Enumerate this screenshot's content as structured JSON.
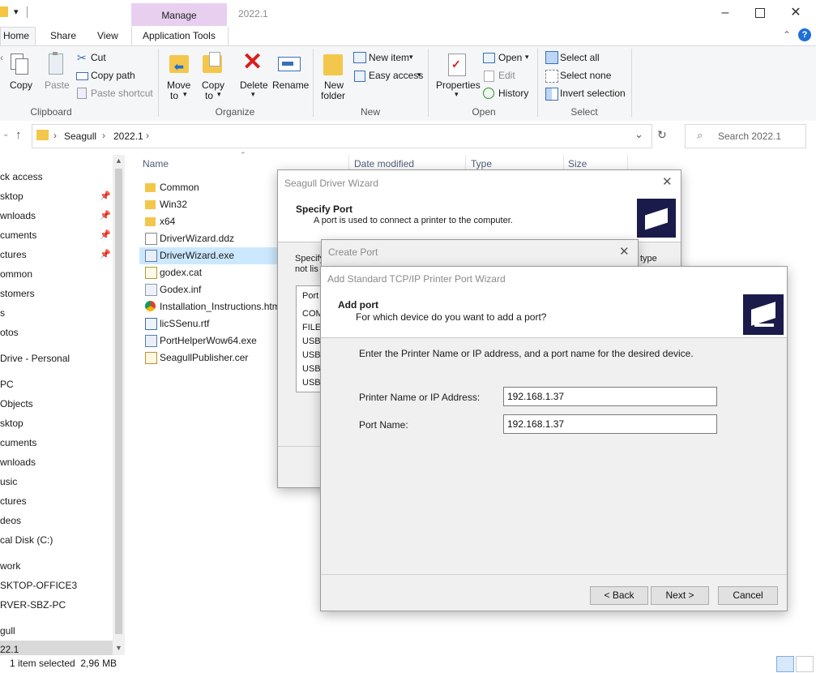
{
  "window": {
    "title": "2022.1",
    "context_tab": "Manage",
    "tabs": [
      "Home",
      "Share",
      "View",
      "Application Tools"
    ]
  },
  "ribbon": {
    "clipboard": {
      "copy": "Copy",
      "paste": "Paste",
      "cut": "Cut",
      "copy_path": "Copy path",
      "paste_shortcut": "Paste shortcut",
      "label": "Clipboard"
    },
    "organize": {
      "move_to": "Move",
      "move_to_2": "to",
      "copy_to": "Copy",
      "copy_to_2": "to",
      "delete": "Delete",
      "rename": "Rename",
      "label": "Organize"
    },
    "new": {
      "new_folder": "New",
      "new_folder_2": "folder",
      "new_item": "New item",
      "easy_access": "Easy access",
      "label": "New"
    },
    "open": {
      "properties": "Properties",
      "open": "Open",
      "edit": "Edit",
      "history": "History",
      "label": "Open"
    },
    "select": {
      "select_all": "Select all",
      "select_none": "Select none",
      "invert": "Invert selection",
      "label": "Select"
    }
  },
  "address": {
    "crumbs": [
      "Seagull",
      "2022.1"
    ],
    "search_placeholder": "Search 2022.1"
  },
  "nav": [
    {
      "label": "ck access",
      "pinned": false
    },
    {
      "label": "sktop",
      "pinned": true
    },
    {
      "label": "wnloads",
      "pinned": true
    },
    {
      "label": "cuments",
      "pinned": true
    },
    {
      "label": "ctures",
      "pinned": true
    },
    {
      "label": "ommon",
      "pinned": false
    },
    {
      "label": "stomers",
      "pinned": false
    },
    {
      "label": "s",
      "pinned": false
    },
    {
      "label": "otos",
      "pinned": false
    },
    {
      "label": "Drive - Personal",
      "pinned": false
    },
    {
      "label": "PC",
      "pinned": false
    },
    {
      "label": "Objects",
      "pinned": false
    },
    {
      "label": "sktop",
      "pinned": false
    },
    {
      "label": "cuments",
      "pinned": false
    },
    {
      "label": "wnloads",
      "pinned": false
    },
    {
      "label": "usic",
      "pinned": false
    },
    {
      "label": "ctures",
      "pinned": false
    },
    {
      "label": "deos",
      "pinned": false
    },
    {
      "label": "cal Disk (C:)",
      "pinned": false
    },
    {
      "label": "work",
      "pinned": false
    },
    {
      "label": "SKTOP-OFFICE3",
      "pinned": false
    },
    {
      "label": "RVER-SBZ-PC",
      "pinned": false
    },
    {
      "label": "gull",
      "pinned": false
    },
    {
      "label": "22.1",
      "pinned": false
    }
  ],
  "columns": [
    "Name",
    "Date modified",
    "Type",
    "Size"
  ],
  "files": [
    {
      "name": "Common",
      "icon": "folder"
    },
    {
      "name": "Win32",
      "icon": "folder"
    },
    {
      "name": "x64",
      "icon": "folder"
    },
    {
      "name": "DriverWizard.ddz",
      "icon": "file"
    },
    {
      "name": "DriverWizard.exe",
      "icon": "exe"
    },
    {
      "name": "godex.cat",
      "icon": "cat"
    },
    {
      "name": "Godex.inf",
      "icon": "inf"
    },
    {
      "name": "Installation_Instructions.htm",
      "icon": "chrome"
    },
    {
      "name": "licSSenu.rtf",
      "icon": "rtf"
    },
    {
      "name": "PortHelperWow64.exe",
      "icon": "exe2"
    },
    {
      "name": "SeagullPublisher.cer",
      "icon": "cert"
    }
  ],
  "status": {
    "text": "1 item selected  2,96 MB"
  },
  "driver_wizard": {
    "title": "Seagull Driver Wizard",
    "heading": "Specify Port",
    "subheading": "A port is used to connect a printer to the computer.",
    "partial_1": "Specify",
    "partial_2": "not lis",
    "partial_type": "type",
    "port_col": "Port",
    "ports": [
      "COM",
      "FILE",
      "USB0",
      "USB0",
      "USB0",
      "USB0"
    ]
  },
  "create_port": {
    "title": "Create Port"
  },
  "tcpip_wizard": {
    "title": "Add Standard TCP/IP Printer Port Wizard",
    "heading": "Add port",
    "subheading": "For which device do you want to add a port?",
    "instructions": "Enter the Printer Name or IP address, and a port name for the desired device.",
    "printer_label": "Printer Name or IP Address:",
    "printer_value": "192.168.1.37",
    "port_label": "Port Name:",
    "port_value": "192.168.1.37",
    "back": "< Back",
    "next": "Next >",
    "cancel": "Cancel"
  }
}
